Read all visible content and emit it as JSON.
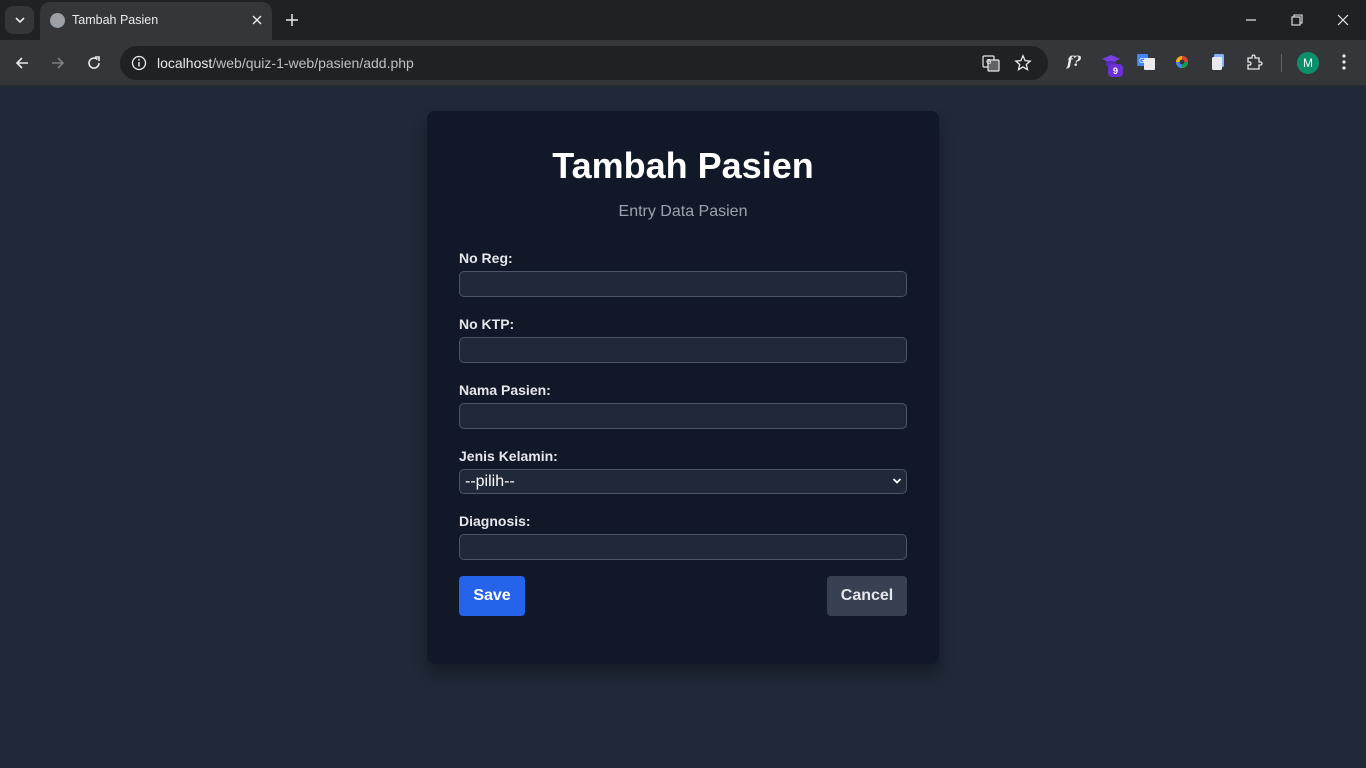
{
  "browser": {
    "tab_title": "Tambah Pasien",
    "url_host": "localhost",
    "url_path": "/web/quiz-1-web/pasien/add.php",
    "extension_badge": "9",
    "profile_initial": "M"
  },
  "page": {
    "title": "Tambah Pasien",
    "subtitle": "Entry Data Pasien",
    "fields": [
      {
        "label": "No Reg:",
        "value": ""
      },
      {
        "label": "No KTP:",
        "value": ""
      },
      {
        "label": "Nama Pasien:",
        "value": ""
      },
      {
        "label": "Jenis Kelamin:",
        "value": "--pilih--"
      },
      {
        "label": "Diagnosis:",
        "value": ""
      }
    ],
    "save_label": "Save",
    "cancel_label": "Cancel"
  },
  "colors": {
    "page_bg": "#1f2937",
    "card_bg": "#111827",
    "save_bg": "#2563eb",
    "cancel_bg": "#374151"
  }
}
